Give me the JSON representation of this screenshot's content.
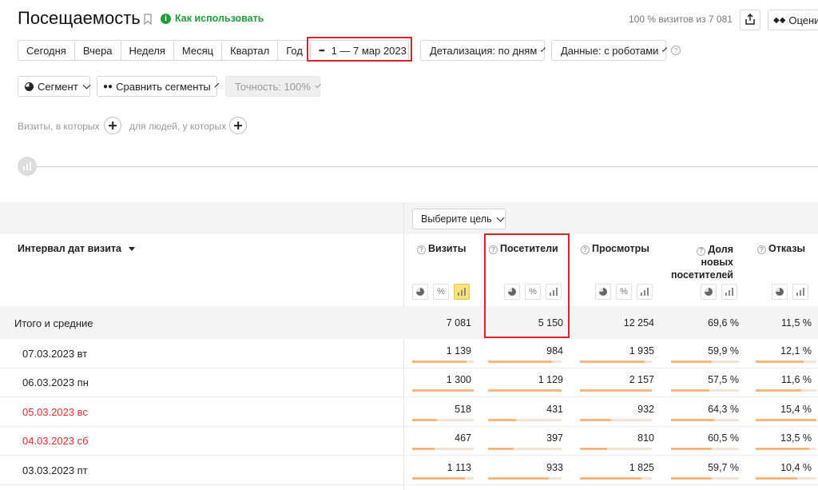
{
  "header": {
    "title": "Посещаемость",
    "how_to_use": "Как использовать",
    "visits_share": "100 % визитов из 7 081",
    "rate_label": "Оценит"
  },
  "periods": [
    "Сегодня",
    "Вчера",
    "Неделя",
    "Месяц",
    "Квартал",
    "Год"
  ],
  "date_range": "1 — 7 мар 2023",
  "detail_label": "Детализация: по дням",
  "data_label": "Данные: с роботами",
  "segment_label": "Сегмент",
  "compare_label": "Сравнить сегменты",
  "accuracy_label": "Точность: 100%",
  "filter": {
    "visits_where": "Визиты, в которых",
    "for_people": "для людей, у которых"
  },
  "goal_select": "Выберите цель",
  "table": {
    "dim_header": "Интервал дат визита",
    "columns": [
      {
        "label": "Визиты"
      },
      {
        "label": "Посетители"
      },
      {
        "label": "Просмотры"
      },
      {
        "label": "Доля новых посетителей"
      },
      {
        "label": "Отказы"
      }
    ],
    "totals": {
      "label": "Итого и средние",
      "values": [
        "7 081",
        "5 150",
        "12 254",
        "69,6 %",
        "11,5 %"
      ]
    },
    "rows": [
      {
        "date": "07.03.2023 вт",
        "weekend": false,
        "values": [
          "1 139",
          "984",
          "1 935",
          "59,9 %",
          "12,1 %"
        ],
        "fill": [
          0.88,
          0.87,
          0.9,
          0.6,
          0.79
        ]
      },
      {
        "date": "06.03.2023 пн",
        "weekend": false,
        "values": [
          "1 300",
          "1 129",
          "2 157",
          "57,5 %",
          "11,6 %"
        ],
        "fill": [
          1.0,
          1.0,
          1.0,
          0.57,
          0.75
        ]
      },
      {
        "date": "05.03.2023 вс",
        "weekend": true,
        "values": [
          "518",
          "431",
          "932",
          "64,3 %",
          "15,4 %"
        ],
        "fill": [
          0.4,
          0.38,
          0.43,
          0.64,
          1.0
        ]
      },
      {
        "date": "04.03.2023 сб",
        "weekend": true,
        "values": [
          "467",
          "397",
          "810",
          "60,5 %",
          "13,5 %"
        ],
        "fill": [
          0.36,
          0.35,
          0.38,
          0.6,
          0.88
        ]
      },
      {
        "date": "03.03.2023 пт",
        "weekend": false,
        "values": [
          "1 113",
          "933",
          "1 825",
          "59,7 %",
          "10,4 %"
        ],
        "fill": [
          0.86,
          0.83,
          0.85,
          0.6,
          0.68
        ]
      }
    ]
  },
  "colors": {
    "accent_green": "#1e9d3a",
    "weekend_red": "#e02b2b",
    "highlight": "#d8232a",
    "bar": "#f5b97e"
  }
}
